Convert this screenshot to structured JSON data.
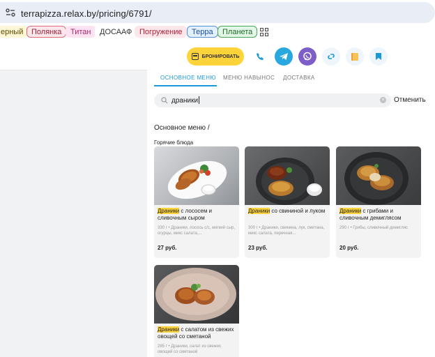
{
  "browser": {
    "url": "terrapizza.relax.by/pricing/6791/"
  },
  "bookmarks": [
    {
      "label": "ерный",
      "bg": "#fff7d6",
      "border": "#fff7d6",
      "color": "#5a4a00"
    },
    {
      "label": "Полянка",
      "bg": "#fde7ea",
      "border": "#e06b7a",
      "color": "#a0213a"
    },
    {
      "label": "Титан",
      "bg": "#fde3f1",
      "border": "#fde3f1",
      "color": "#b0256d"
    },
    {
      "label": "ДОСААФ",
      "bg": "#ffffff",
      "border": "#ffffff",
      "color": "#333333"
    },
    {
      "label": "Погружение",
      "bg": "#fde7ea",
      "border": "#fde7ea",
      "color": "#b0213a"
    },
    {
      "label": "Терра",
      "bg": "#e3f0ff",
      "border": "#5a8fd6",
      "color": "#1a4fa0"
    },
    {
      "label": "Планета",
      "bg": "#e3f7e6",
      "border": "#4aa35a",
      "color": "#1e6b2c"
    }
  ],
  "header": {
    "book_label": "БРОНИРОВАТЬ"
  },
  "tabs": [
    "ОСНОВНОЕ МЕНЮ",
    "МЕНЮ НАВЫНОС",
    "ДОСТАВКА"
  ],
  "search": {
    "query": "драники",
    "cancel": "Отменить"
  },
  "menu": {
    "breadcrumb": "Основное меню /",
    "category": "Горячие блюда",
    "items": [
      {
        "highlight": "Драники",
        "rest": " с лососем и сливочным сыром",
        "desc": "330 г • Драники, лосось с/с, мягкий сыр, огурцы, микс салата,...",
        "price": "27 руб."
      },
      {
        "highlight": "Драники",
        "rest": " со свининой и луком",
        "desc": "300 г • Драники, свинина, лук, сметана, микс салата, перечная...",
        "price": "23 руб."
      },
      {
        "highlight": "Драники",
        "rest": " с грибами и сливочным демиглясом",
        "desc": "290 г • Грибы, сливочный демигляс",
        "price": "20 руб."
      },
      {
        "highlight": "Драники",
        "rest": " с салатом из свежих овощей со сметаной",
        "desc": "285 г • Драники, салат из свежих овощей со сметаной",
        "price": ""
      }
    ]
  }
}
